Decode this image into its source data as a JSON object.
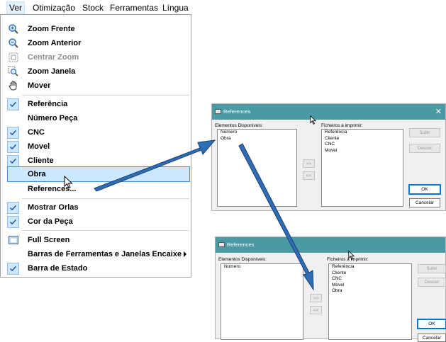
{
  "menubar": {
    "items": [
      "Ver",
      "Otimização",
      "Stock",
      "Ferramentas",
      "Língua"
    ]
  },
  "menu": {
    "zoom_frente": "Zoom Frente",
    "zoom_anterior": "Zoom Anterior",
    "centrar_zoom": "Centrar Zoom",
    "zoom_janela": "Zoom Janela",
    "mover": "Mover",
    "referencia": "Referência",
    "numero_peca": "Número Peça",
    "cnc": "CNC",
    "movel": "Movel",
    "cliente": "Cliente",
    "obra": "Obra",
    "references": "References...",
    "mostrar_orlas": "Mostrar Orlas",
    "cor_peca": "Cor da Peça",
    "full_screen": "Full Screen",
    "barras": "Barras de Ferramentas e Janelas Encaixe",
    "barra_estado": "Barra de Estado"
  },
  "dialog1": {
    "title": "References",
    "available_label": "Elementos Disponíveis:",
    "print_label": "Ficheiros a imprimir:",
    "available": [
      "Número",
      "Obra"
    ],
    "print": [
      "Referência",
      "Cliente",
      "CNC",
      "Movel"
    ],
    "add": ">>",
    "remove": "<<",
    "up": "Subir",
    "down": "Descer",
    "ok": "OK",
    "cancel": "Cancelar"
  },
  "dialog2": {
    "title": "References",
    "available_label": "Elementos Disponíveis:",
    "print_label": "Ficheiros a imprimir:",
    "available": [
      "Número"
    ],
    "print": [
      "Referência",
      "Cliente",
      "CNC",
      "Movel",
      "Obra"
    ],
    "add": ">>",
    "remove": "<<",
    "up": "Subir",
    "down": "Descer",
    "ok": "OK",
    "cancel": "Cancelar"
  },
  "colors": {
    "titlebar": "#4a9aa6",
    "highlight": "#cce8ff",
    "arrow": "#2f6db5"
  }
}
